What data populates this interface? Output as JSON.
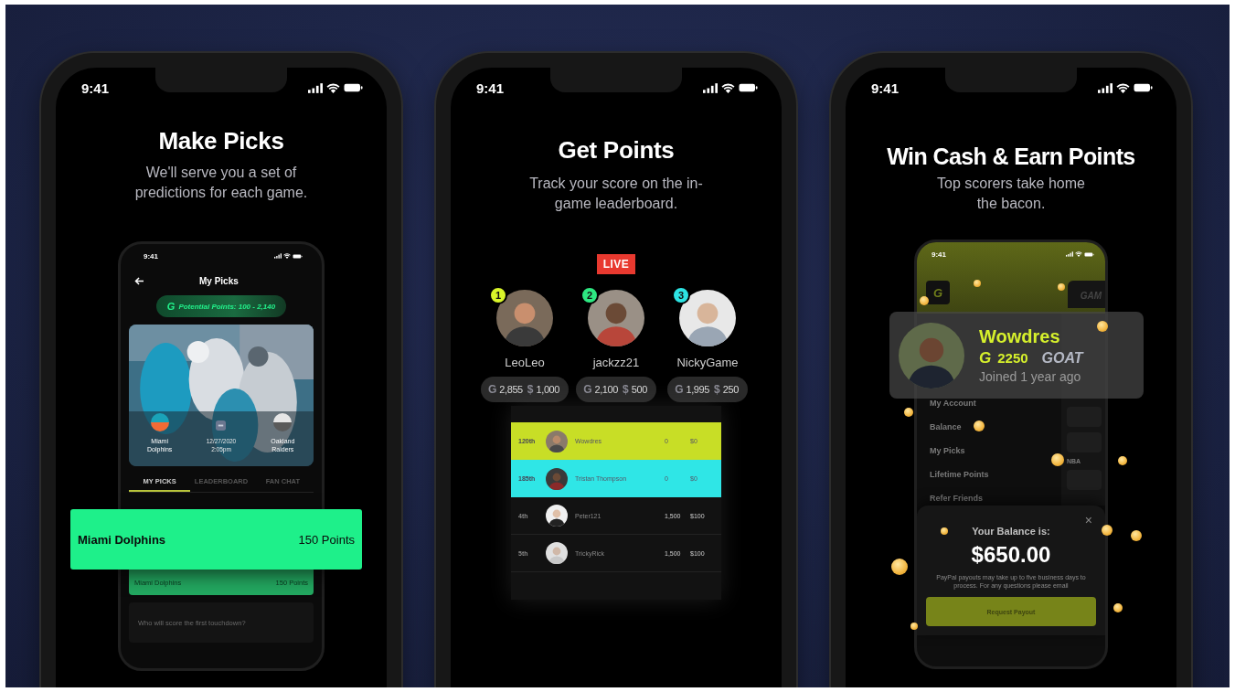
{
  "phones": [
    {
      "kind": "picks",
      "time": "9:41",
      "title": "Make Picks",
      "subtitle": "We'll serve you a set of predictions for each game.",
      "device": {
        "time": "9:41",
        "header": "My Picks",
        "logo": "G",
        "potential": "Potential Points: 100 - 2,140",
        "game": {
          "home": "Miami Dolphins",
          "date": "12/27/2020",
          "start": "2:05pm",
          "away": "Oakland Raiders"
        },
        "tabs": [
          {
            "label": "MY PICKS",
            "selected": true
          },
          {
            "label": "LEADERBOARD",
            "selected": false
          },
          {
            "label": "FAN CHAT",
            "selected": false
          }
        ],
        "pick_row": {
          "team": "Miami Dolphins",
          "points": "150 Points"
        },
        "question": "Who will score the first touchdown?"
      },
      "pick_card": {
        "team": "Miami Dolphins",
        "points": "150 Points"
      }
    },
    {
      "kind": "leaderboard",
      "time": "9:41",
      "title": "Get Points",
      "subtitle": "Track your score on the in-game leaderboard.",
      "live": "LIVE",
      "podium": [
        {
          "rank": "1",
          "name": "LeoLeo",
          "points_symbol": "G",
          "points": "2,855",
          "cash_symbol": "$",
          "cash": "1,000",
          "color": "#d9f52a"
        },
        {
          "rank": "2",
          "name": "jackzz21",
          "points_symbol": "G",
          "points": "2,100",
          "cash_symbol": "$",
          "cash": "500",
          "color": "#2ee882"
        },
        {
          "rank": "3",
          "name": "NickyGame",
          "points_symbol": "G",
          "points": "1,995",
          "cash_symbol": "$",
          "cash": "250",
          "color": "#2de3e3"
        }
      ],
      "rows": [
        {
          "rank": "120th",
          "name": "Wowdres",
          "points": "0",
          "cash": "$0",
          "color": "#c8de26"
        },
        {
          "rank": "185th",
          "name": "Tristan Thompson",
          "points": "0",
          "cash": "$0",
          "color": "#2fe6e6"
        },
        {
          "rank": "4th",
          "name": "Peter121",
          "points": "1,500",
          "cash": "$100"
        },
        {
          "rank": "5th",
          "name": "TrickyRick",
          "points": "1,500",
          "cash": "$100"
        }
      ]
    },
    {
      "kind": "payout",
      "time": "9:41",
      "title": "Win Cash & Earn Points",
      "subtitle": "Top scorers take home the bacon.",
      "device": {
        "time": "9:41",
        "logo": "G",
        "side_label": "GAM",
        "side_tag": "NBA",
        "menu": [
          "My Account",
          "Balance",
          "My Picks",
          "Lifetime Points",
          "Refer Friends"
        ]
      },
      "profile": {
        "name": "Wowdres",
        "logo": "G",
        "points": "2250",
        "rank": "GOAT",
        "joined": "Joined 1 year ago"
      },
      "balance": {
        "label": "Your Balance is:",
        "amount": "$650.00",
        "close": "×",
        "note": "PayPal payouts may take up to five business days to process. For any questions please email",
        "button": "Request Payout"
      }
    }
  ]
}
